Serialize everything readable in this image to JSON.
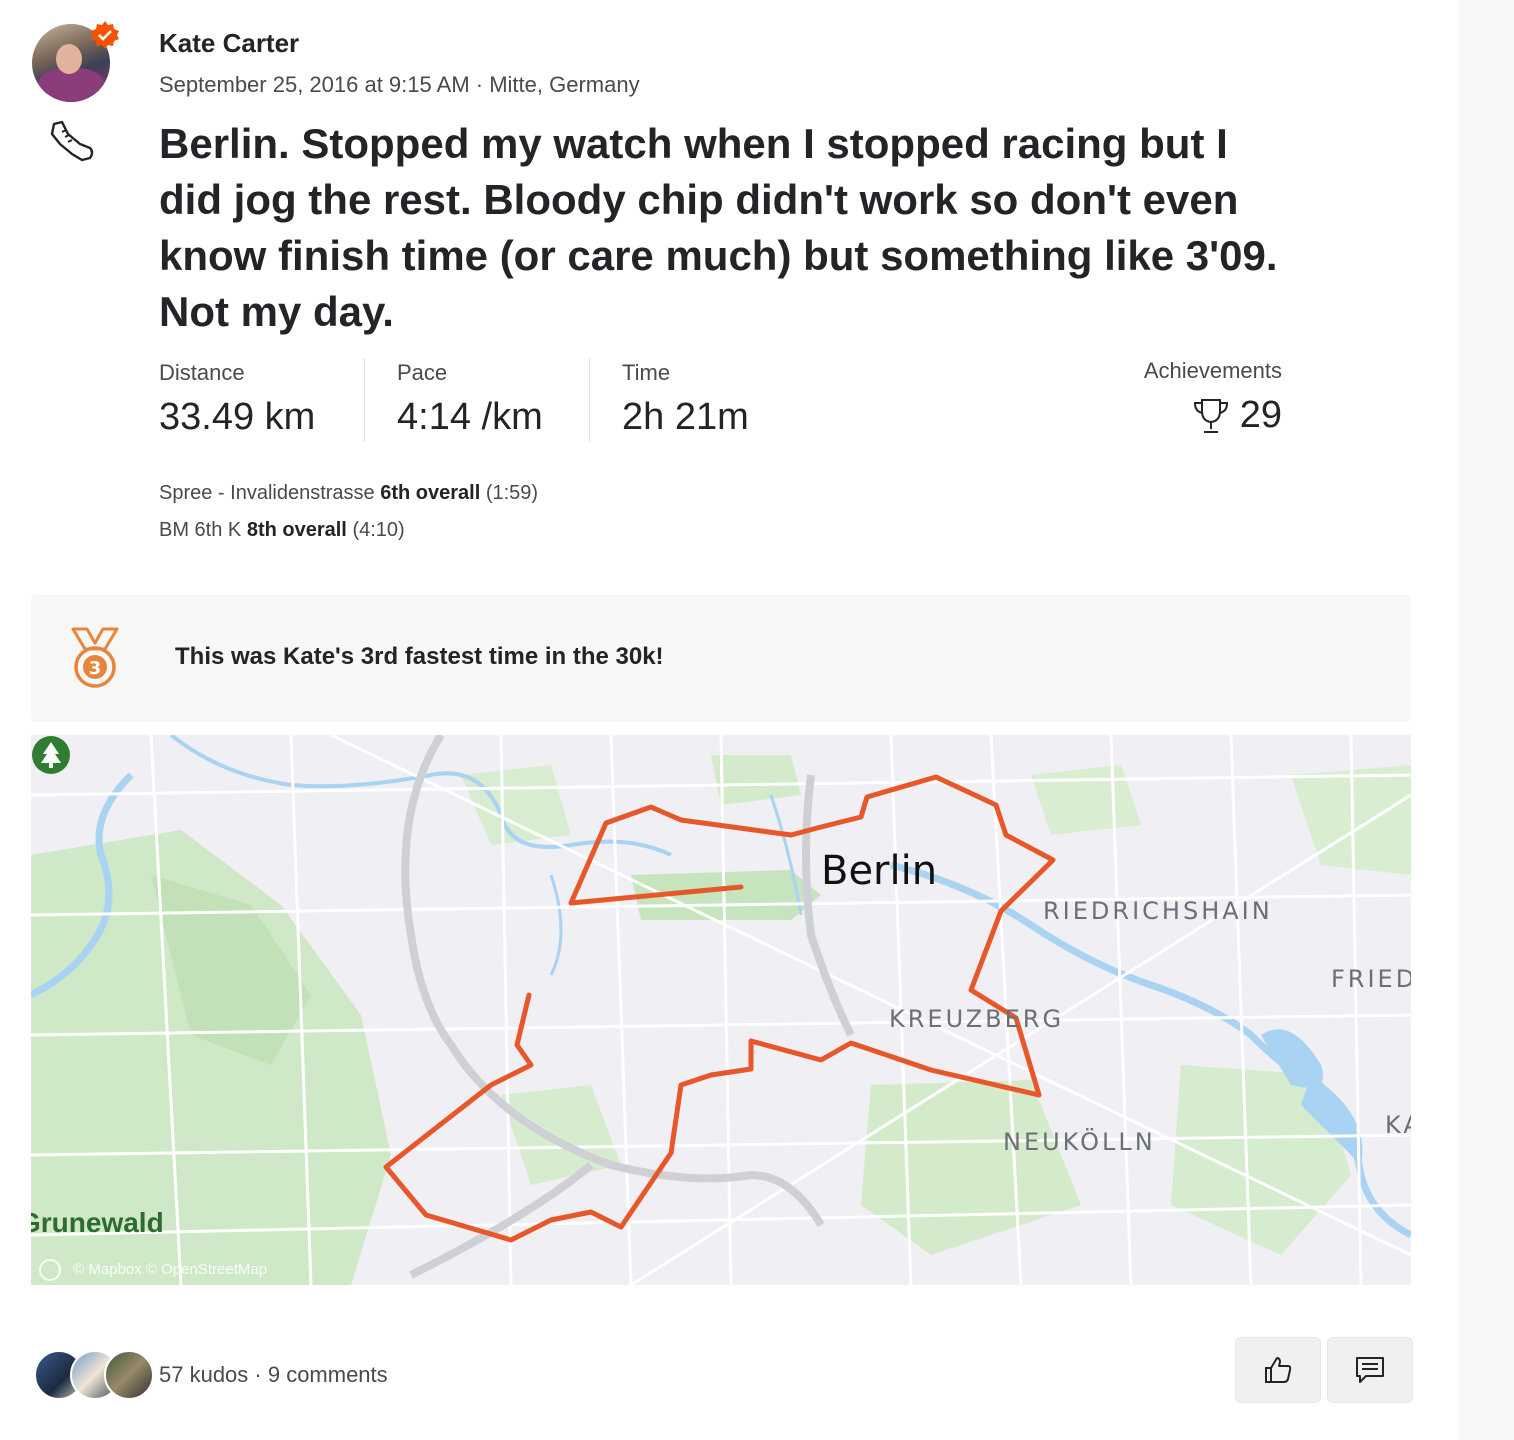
{
  "athlete": {
    "name": "Kate Carter",
    "meta": "September 25, 2016 at 9:15 AM · Mitte, Germany",
    "activity_icon": "running-shoe-icon"
  },
  "activity": {
    "title": "Berlin. Stopped my watch when I stopped racing but I did jog the rest. Bloody chip didn't work so don't even know finish time (or care much) but something like 3'09. Not my day."
  },
  "stats": {
    "distance": {
      "label": "Distance",
      "value": "33.49 km"
    },
    "pace": {
      "label": "Pace",
      "value": "4:14 /km"
    },
    "time": {
      "label": "Time",
      "value": "2h 21m"
    },
    "achievements": {
      "label": "Achievements",
      "value": "29",
      "icon": "trophy-icon"
    }
  },
  "segments": [
    {
      "name": "Spree - Invalidenstrasse",
      "rank": "6th overall",
      "time": "(1:59)"
    },
    {
      "name": "BM 6th K",
      "rank": "8th overall",
      "time": "(4:10)"
    }
  ],
  "banner": {
    "text": "This was Kate's 3rd fastest time in the 30k!",
    "medal_number": "3",
    "medal_color": "#e8843c"
  },
  "map": {
    "city_label": "Berlin",
    "districts": [
      "RIEDRICHSHAIN",
      "FRIED",
      "KREUZBERG",
      "NEUKÖLLN",
      "KA"
    ],
    "park_label": "Grunewald",
    "attribution": "© Mapbox © OpenStreetMap",
    "route_color": "#e8572a"
  },
  "footer": {
    "kudos_text": "57 kudos · 9 comments",
    "kudos_button_icon": "thumbs-up-icon",
    "comment_button_icon": "comment-icon"
  },
  "colors": {
    "brand": "#fc5200",
    "text": "#242428",
    "muted": "#494950"
  }
}
